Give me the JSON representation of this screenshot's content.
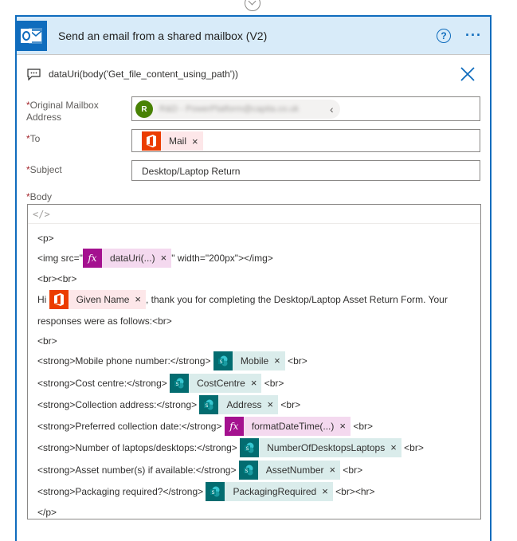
{
  "header": {
    "title": "Send an email from a shared mailbox (V2)",
    "help_label": "?",
    "more_label": "···",
    "brand_color": "#0f6cbd"
  },
  "subheader": {
    "expression": "dataUri(body('Get_file_content_using_path'))"
  },
  "fields": {
    "mailbox": {
      "label": "Original Mailbox Address",
      "avatar_letter": "R",
      "value": "R&D - PowerPlatform@capita.co.uk",
      "chevron": "‹"
    },
    "to": {
      "label": "To",
      "token": "Mail",
      "token_icon": "office-icon"
    },
    "subject": {
      "label": "Subject",
      "value": "Desktop/Laptop Return"
    },
    "body": {
      "label": "Body",
      "code_toggle": "</>"
    }
  },
  "required_mark": "*",
  "remove_mark": "×",
  "body_lines": {
    "l1": "<p>",
    "l2_a": "<img src=\"",
    "l2_token": "dataUri(...)",
    "l2_b": "\" width=\"200px\"></img>",
    "l3": "<br><br>",
    "l4_a": "Hi ",
    "l4_token": "Given Name",
    "l4_b": ", thank you for completing the Desktop/Laptop Asset Return Form. Your",
    "l5": "responses were as follows:<br>",
    "l6": "<br>",
    "l7_a": "<strong>Mobile phone number:</strong> ",
    "l7_token": "Mobile",
    "l7_b": " <br>",
    "l8_a": "<strong>Cost centre:</strong> ",
    "l8_token": "CostCentre",
    "l8_b": " <br>",
    "l9_a": "<strong>Collection address:</strong> ",
    "l9_token": "Address",
    "l9_b": " <br>",
    "l10_a": "<strong>Preferred collection date:</strong> ",
    "l10_token": "formatDateTime(...)",
    "l10_b": " <br>",
    "l11_a": "<strong>Number of laptops/desktops:</strong> ",
    "l11_token": "NumberOfDesktopsLaptops",
    "l11_b": " <br>",
    "l12_a": "<strong>Asset number(s) if available:</strong> ",
    "l12_token": "AssetNumber",
    "l12_b": " <br>",
    "l13_a": "<strong>Packaging required?</strong> ",
    "l13_token": "PackagingRequired",
    "l13_b": " <br><hr>",
    "l14": "</p>"
  },
  "token_colors": {
    "office": "#eb3c00",
    "expression": "#a4118f",
    "sharepoint": "#036c70"
  }
}
